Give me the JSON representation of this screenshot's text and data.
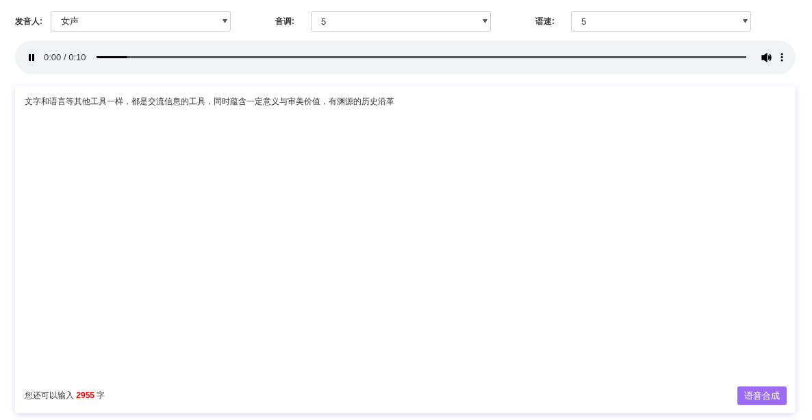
{
  "controls": [
    {
      "label": "发音人:",
      "value": "女声"
    },
    {
      "label": "音调:",
      "value": "5"
    },
    {
      "label": "语速:",
      "value": "5"
    }
  ],
  "player": {
    "playing": true,
    "time": "0:00 / 0:10",
    "level": 0.047
  },
  "editor": {
    "value": "文字和语言等其他工具一样，都是交流信息的工具，同时蕴含一定意义与审美价值，有渊源的历史沿革"
  },
  "counter": "您还可以输入 **2955** 字",
  "submit_button": "语音合成"
}
